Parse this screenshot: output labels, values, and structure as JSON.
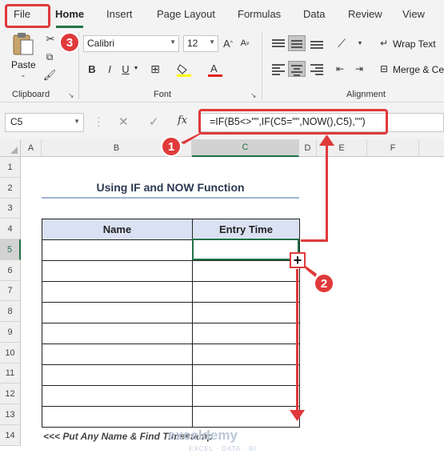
{
  "tabs": [
    "File",
    "Home",
    "Insert",
    "Page Layout",
    "Formulas",
    "Data",
    "Review",
    "View"
  ],
  "ribbon": {
    "clipboard": {
      "paste_label": "Paste",
      "group_label": "Clipboard"
    },
    "font": {
      "font_name": "Calibri",
      "font_size": "12",
      "group_label": "Font"
    },
    "alignment": {
      "wrap_text": "Wrap Text",
      "merge": "Merge & Ce",
      "group_label": "Alignment"
    }
  },
  "formula_bar": {
    "name_box": "C5",
    "fx": "fx",
    "formula": "=IF(B5<>\"\",IF(C5=\"\",NOW(),C5),\"\")"
  },
  "columns": [
    "A",
    "B",
    "C",
    "D",
    "E",
    "F"
  ],
  "rows": [
    "1",
    "2",
    "3",
    "4",
    "5",
    "6",
    "7",
    "8",
    "9",
    "10",
    "11",
    "12",
    "13",
    "14"
  ],
  "sheet": {
    "title": "Using IF and NOW Function",
    "headers": {
      "name": "Name",
      "entry_time": "Entry Time"
    },
    "footnote": "<<< Put Any Name & Find Timestamp",
    "watermark": "exceldemy",
    "watermark_sub": "EXCEL · DATA · BI"
  },
  "annotations": {
    "one": "1",
    "two": "2",
    "three": "3"
  },
  "colors": {
    "annotation": "#e0393b",
    "excel_green": "#217346",
    "header_fill": "#d9e1f2"
  }
}
